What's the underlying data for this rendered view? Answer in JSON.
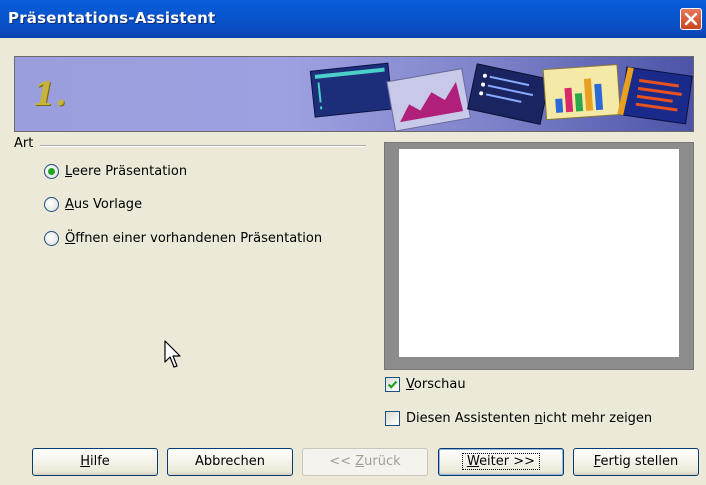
{
  "window": {
    "title": "Präsentations-Assistent"
  },
  "banner": {
    "step": "1."
  },
  "art": {
    "label": "Art",
    "options": [
      {
        "accel": "L",
        "rest": "eere Präsentation",
        "selected": true
      },
      {
        "accel": "A",
        "rest": "us Vorlage",
        "selected": false
      },
      {
        "accel": "Ö",
        "rest": "ffnen einer vorhandenen Präsentation",
        "selected": false
      }
    ]
  },
  "checks": {
    "preview": {
      "accel": "V",
      "rest": "orschau",
      "checked": true
    },
    "dont_show": {
      "pre": "Diesen Assistenten ",
      "accel": "n",
      "rest": "icht mehr zeigen",
      "checked": false
    }
  },
  "buttons": {
    "help": {
      "accel": "H",
      "rest": "ilfe"
    },
    "cancel": {
      "label": "Abbrechen"
    },
    "back": {
      "pre": "<< ",
      "accel": "Z",
      "rest": "urück"
    },
    "next": {
      "accel": "W",
      "rest": "eiter >>"
    },
    "finish": {
      "accel": "F",
      "rest": "ertig stellen"
    }
  },
  "colors": {
    "titlebar": "#0855d0",
    "radio_dot": "#21a121",
    "check_mark": "#21a121"
  }
}
